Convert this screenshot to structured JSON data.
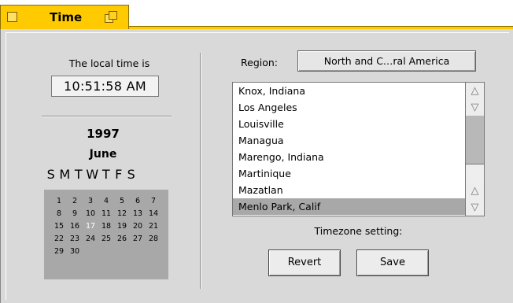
{
  "window": {
    "title": "Time",
    "close_icon": "close-box-icon",
    "zoom_icon": "zoom-box-icon",
    "accent_color": "#ffcb00"
  },
  "clock": {
    "label": "The local time is",
    "time": "10:51:58 AM"
  },
  "calendar": {
    "year": "1997",
    "month": "June",
    "weekdays": [
      "S",
      "M",
      "T",
      "W",
      "T",
      "F",
      "S"
    ],
    "weeks": [
      [
        "1",
        "2",
        "3",
        "4",
        "5",
        "6",
        "7"
      ],
      [
        "8",
        "9",
        "10",
        "11",
        "12",
        "13",
        "14"
      ],
      [
        "15",
        "16",
        "17",
        "18",
        "19",
        "20",
        "21"
      ],
      [
        "22",
        "23",
        "24",
        "25",
        "26",
        "27",
        "28"
      ],
      [
        "29",
        "30",
        "",
        "",
        "",
        "",
        ""
      ]
    ],
    "today": "17"
  },
  "region": {
    "label": "Region:",
    "value": "North and C…ral America"
  },
  "timezones": {
    "items": [
      "Knox, Indiana",
      "Los Angeles",
      "Louisville",
      "Managua",
      "Marengo, Indiana",
      "Martinique",
      "Mazatlan",
      "Menlo Park, Calif"
    ],
    "selected": "Menlo Park, Calif",
    "scroll_up_icon": "scroll-up-arrow-icon",
    "scroll_down_icon": "scroll-down-arrow-icon"
  },
  "timezone_setting_label": "Timezone setting:",
  "buttons": {
    "revert": "Revert",
    "save": "Save"
  }
}
